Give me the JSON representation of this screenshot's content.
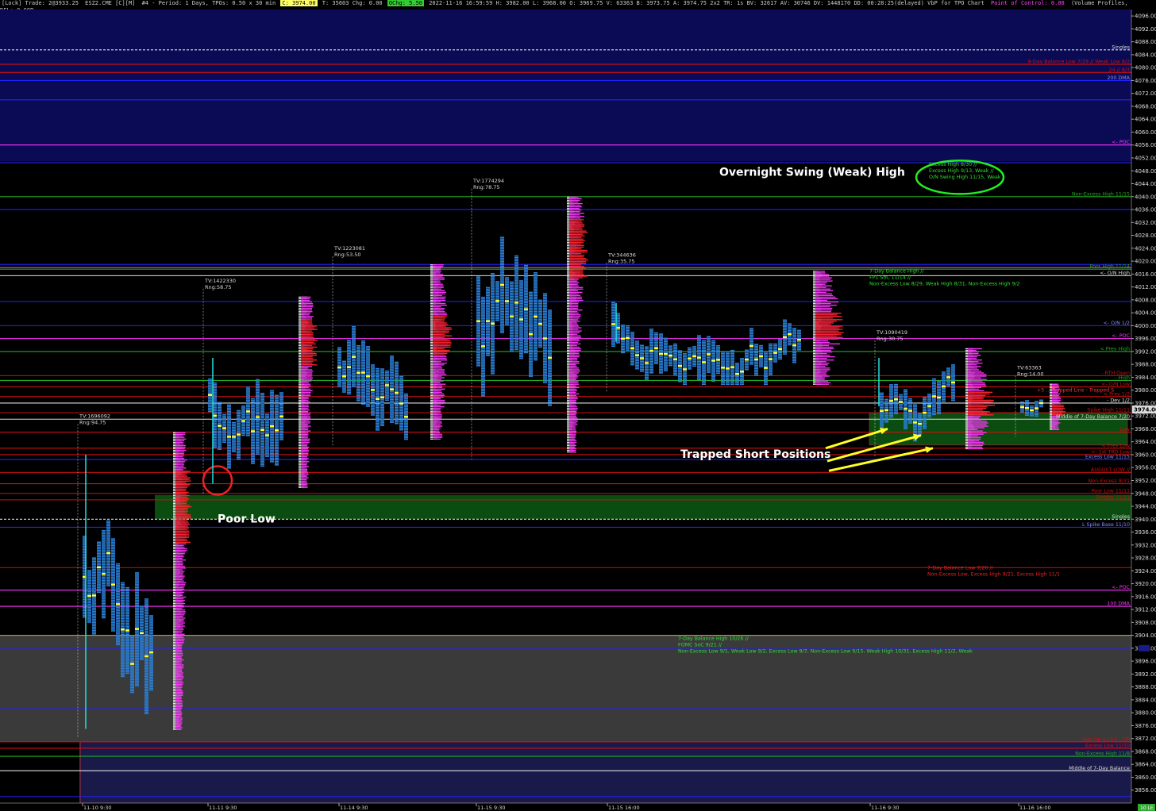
{
  "header": {
    "lock": "[Lock] Trade: 2@3933.25",
    "symbol": "ESZ2.CME [C][M]",
    "info": "#4 - Period: 1 Days, TPOs: 0.50 x 30 min",
    "last": "C: 3974.00",
    "misc": "T: 35603  Chg: 0.00",
    "ochg": "OChg: 5.50",
    "stats": "2022-11-16 16:59:59 H: 3982.00 L: 3968.00 O: 3969.75 V: 63363 B: 3973.75 A: 3974.75 2x2 TR: 1s BV: 32617 AV: 30746 DV: 1448170 DD: 00:28:25(delayed) VbP for TPO Chart",
    "poc": "Point of Control: 0.00",
    "study": "(Volume Profiles, 0, 2, Based On TPO Chart, No, Days, 1, 50, 1000000, 0, 0, No, 00:00:00, 0, 00:00:00, No, No, Window Width, 70, No, No, Ye",
    "dfl": "DFL: 0.00P"
  },
  "colors": {
    "bg": "#000000",
    "navy": "#0b0b55",
    "grey": "#3a3a3a",
    "green_zone": "#0b4d10",
    "tpo_blue": "#2a7fd6",
    "tpo_white": "#e8e8e8",
    "poc_yellow": "#ffff33",
    "profile_magenta": "#ff33ff",
    "profile_red": "#ff2222",
    "line_blue": "#2222ff",
    "line_magenta": "#ff33ff",
    "line_red": "#cc1111",
    "line_green": "#22aa22"
  },
  "chart_data": {
    "type": "tpo_market_profile",
    "y_axis": {
      "min": 3852,
      "max": 4098,
      "ticks": [
        4096,
        4092,
        4088,
        4084,
        4080,
        4076,
        4072,
        4068,
        4064,
        4060,
        4056,
        4052,
        4048,
        4044,
        4040,
        4036,
        4032,
        4028,
        4024,
        4020,
        4016,
        4012,
        4008,
        4004,
        4000,
        3996,
        3992,
        3988,
        3984,
        3980,
        3976,
        3972,
        3968,
        3964,
        3960,
        3956,
        3952,
        3948,
        3944,
        3940,
        3936,
        3932,
        3928,
        3924,
        3920,
        3916,
        3912,
        3908,
        3904,
        3900,
        3896,
        3892,
        3888,
        3884,
        3880,
        3876,
        3872,
        3868,
        3864,
        3860,
        3856
      ],
      "last_price": "3974.00"
    },
    "x_labels": [
      "11-10 9:30",
      "11-11 9:30",
      "11-14 9:30",
      "11-15 9:30",
      "11-15 16:00",
      "11-16 9:30",
      "11-16 16:00"
    ],
    "sessions": [
      {
        "tv": "TV:1696092",
        "rng": "Rng:94.75",
        "low": 3875,
        "high": 3967,
        "poc": 3944
      },
      {
        "tv": "TV:1422330",
        "rng": "Rng:58.75",
        "low": 3950,
        "high": 4009,
        "poc": 3995
      },
      {
        "tv": "TV:1223081",
        "rng": "Rng:53.50",
        "low": 3965,
        "high": 4019,
        "poc": 3997
      },
      {
        "tv": "TV:1774294",
        "rng": "Rng:78.75",
        "low": 3961,
        "high": 4040,
        "poc": 4024
      },
      {
        "tv": "TV:344636",
        "rng": "Rng:35.75",
        "low": 3982,
        "high": 4017,
        "poc": 4000
      },
      {
        "tv": "TV:1090419",
        "rng": "Rng:30.75",
        "low": 3962,
        "high": 3993,
        "poc": 3976
      },
      {
        "tv": "TV:63363",
        "rng": "Rng:14.00",
        "low": 3968,
        "high": 3982,
        "poc": 3974
      }
    ],
    "zones": [
      {
        "name": "navy",
        "from": 4098,
        "to": 4051
      },
      {
        "name": "green_poor_low",
        "from": 3947.5,
        "to": 3940
      },
      {
        "name": "green_trapped",
        "from": 3973,
        "to": 3963
      },
      {
        "name": "grey",
        "from": 3904,
        "to": 3871
      },
      {
        "name": "navy_low",
        "from": 3871,
        "to": 3852
      }
    ],
    "levels": [
      {
        "price": 4085.5,
        "color": "#dddddd",
        "dashed": true,
        "label": "Singles"
      },
      {
        "price": 4081,
        "color": "#cc1111",
        "label": "8-Day Balance Low 7/29 // Weak Low 8/2"
      },
      {
        "price": 4078.5,
        "color": "#cc1111",
        "label": "24 // 8/3"
      },
      {
        "price": 4076,
        "color": "#2222ff",
        "label": "200 DMA"
      },
      {
        "price": 4070,
        "color": "#2222ff",
        "label": ""
      },
      {
        "price": 4056,
        "color": "#ff33ff",
        "label": "<- POC"
      },
      {
        "price": 4050.5,
        "color": "#2222ff",
        "label": ""
      },
      {
        "price": 4040,
        "color": "#22aa22",
        "label": "Non-Excess High 11/15"
      },
      {
        "price": 4036,
        "color": "#2222ff",
        "label": ""
      },
      {
        "price": 4019,
        "color": "#2222ff",
        "label": ""
      },
      {
        "price": 4018,
        "color": "#ff33ff",
        "label": ""
      },
      {
        "price": 4017.5,
        "color": "#22aa22",
        "label": "Poor High 11/14"
      },
      {
        "price": 4015.5,
        "color": "#dddddd",
        "label": "<- O/N High"
      },
      {
        "price": 4007.5,
        "color": "#2222ff",
        "label": ""
      },
      {
        "price": 4000,
        "color": "#2222ff",
        "label": "<- O/N 1/2"
      },
      {
        "price": 3996,
        "color": "#ff33ff",
        "label": "<- POC"
      },
      {
        "price": 3992,
        "color": "#22aa22",
        "label": "< Prev High"
      },
      {
        "price": 3984.5,
        "color": "#cc1111",
        "label": "- RTH Open"
      },
      {
        "price": 3983,
        "color": "#22aa22",
        "label": "- High"
      },
      {
        "price": 3981,
        "color": "#cc1111",
        "label": "<- O/N Low"
      },
      {
        "price": 3978,
        "color": "#cc1111",
        "label": "< Prev 1/2"
      },
      {
        "price": 3976,
        "color": "#dddddd",
        "label": "- Dev 1/2"
      },
      {
        "price": 3973,
        "color": "#cc1111",
        "label": "Spike High 11/11"
      },
      {
        "price": 3971,
        "color": "#dddddd",
        "label": "Middle of 7-Day Balance 7/20"
      },
      {
        "price": 3967,
        "color": "#cc1111",
        "label": "- Low"
      },
      {
        "price": 3962,
        "color": "#cc1111",
        "label": "< Prev Low"
      },
      {
        "price": 3960,
        "color": "#cc1111",
        "label": "<- 1st TRD Low"
      },
      {
        "price": 3958.5,
        "color": "#2222ff",
        "label": "Excess Low 11/15"
      },
      {
        "price": 3954.5,
        "color": "#cc1111",
        "label": "AUGUST LOW //"
      },
      {
        "price": 3951,
        "color": "#cc1111",
        "label": "Non-Excess 8/31"
      },
      {
        "price": 3948,
        "color": "#cc1111",
        "label": "Poor Low 11/11"
      },
      {
        "price": 3946,
        "color": "#cc1111",
        "label": "Singles 11/11"
      },
      {
        "price": 3940,
        "color": "#dddddd",
        "dashed": true,
        "label": "Singles"
      },
      {
        "price": 3937.5,
        "color": "#2222ff",
        "label": "L Spike Base 11/10"
      },
      {
        "price": 3925,
        "color": "#cc1111",
        "label": ""
      },
      {
        "price": 3918,
        "color": "#ff33ff",
        "label": "<- POC"
      },
      {
        "price": 3913,
        "color": "#ff33ff",
        "label": "100 DMA"
      },
      {
        "price": 3904,
        "color": "#ddaa33",
        "label": ""
      },
      {
        "price": 3900,
        "color": "#2222ff",
        "label": ""
      },
      {
        "price": 3881.5,
        "color": "#2222ff",
        "label": ""
      },
      {
        "price": 3871,
        "color": "#cc1111",
        "label": "Gap Up 11/10 - CPI"
      },
      {
        "price": 3869,
        "color": "#cc1111",
        "label": "Excess Low 11/10"
      },
      {
        "price": 3866.5,
        "color": "#22aa22",
        "label": "Non-Excess High 11/8"
      },
      {
        "price": 3862,
        "color": "#dddddd",
        "label": "Middle of 7-Day Balance"
      },
      {
        "price": 3854,
        "color": "#2222ff",
        "label": ""
      }
    ],
    "notes": [
      {
        "lines": [
          "7-Day Balance High //",
          "FP1 SoC 11/14 //",
          "Non-Excess Low 8/29, Weak High 8/31, Non-Excess High 9/2"
        ],
        "color": "#33dd33"
      },
      {
        "lines": [
          "7-Day Balance Low 7/20 //",
          "Non-Excess Low, Excess High 9/21, Excess High 11/1"
        ],
        "color": "#ee2222"
      },
      {
        "lines": [
          "7-Day Balance High 10/26 //",
          "FOMC SoC 9/21 //",
          "Non-Excess Low 9/1, Weak Low 9/2, Excess Low 9/7, Non-Excess Low 9/15, Weak High 10/31, Excess High 11/2, Weak"
        ],
        "color": "#33dd33"
      },
      {
        "lines": [
          "Excess High 8/30 //",
          "Excess High 9/13, Weak //",
          "O/N Swing High 11/15, Weak"
        ],
        "color": "#33dd33"
      }
    ],
    "annotations": {
      "overnight": "Overnight Swing (Weak) High",
      "poor_low": "Poor Low",
      "trapped": "Trapped Short Positions",
      "trapped_line": "+5 ... Trapped Line - Trapped S"
    },
    "corner_tag": "10 LE"
  }
}
